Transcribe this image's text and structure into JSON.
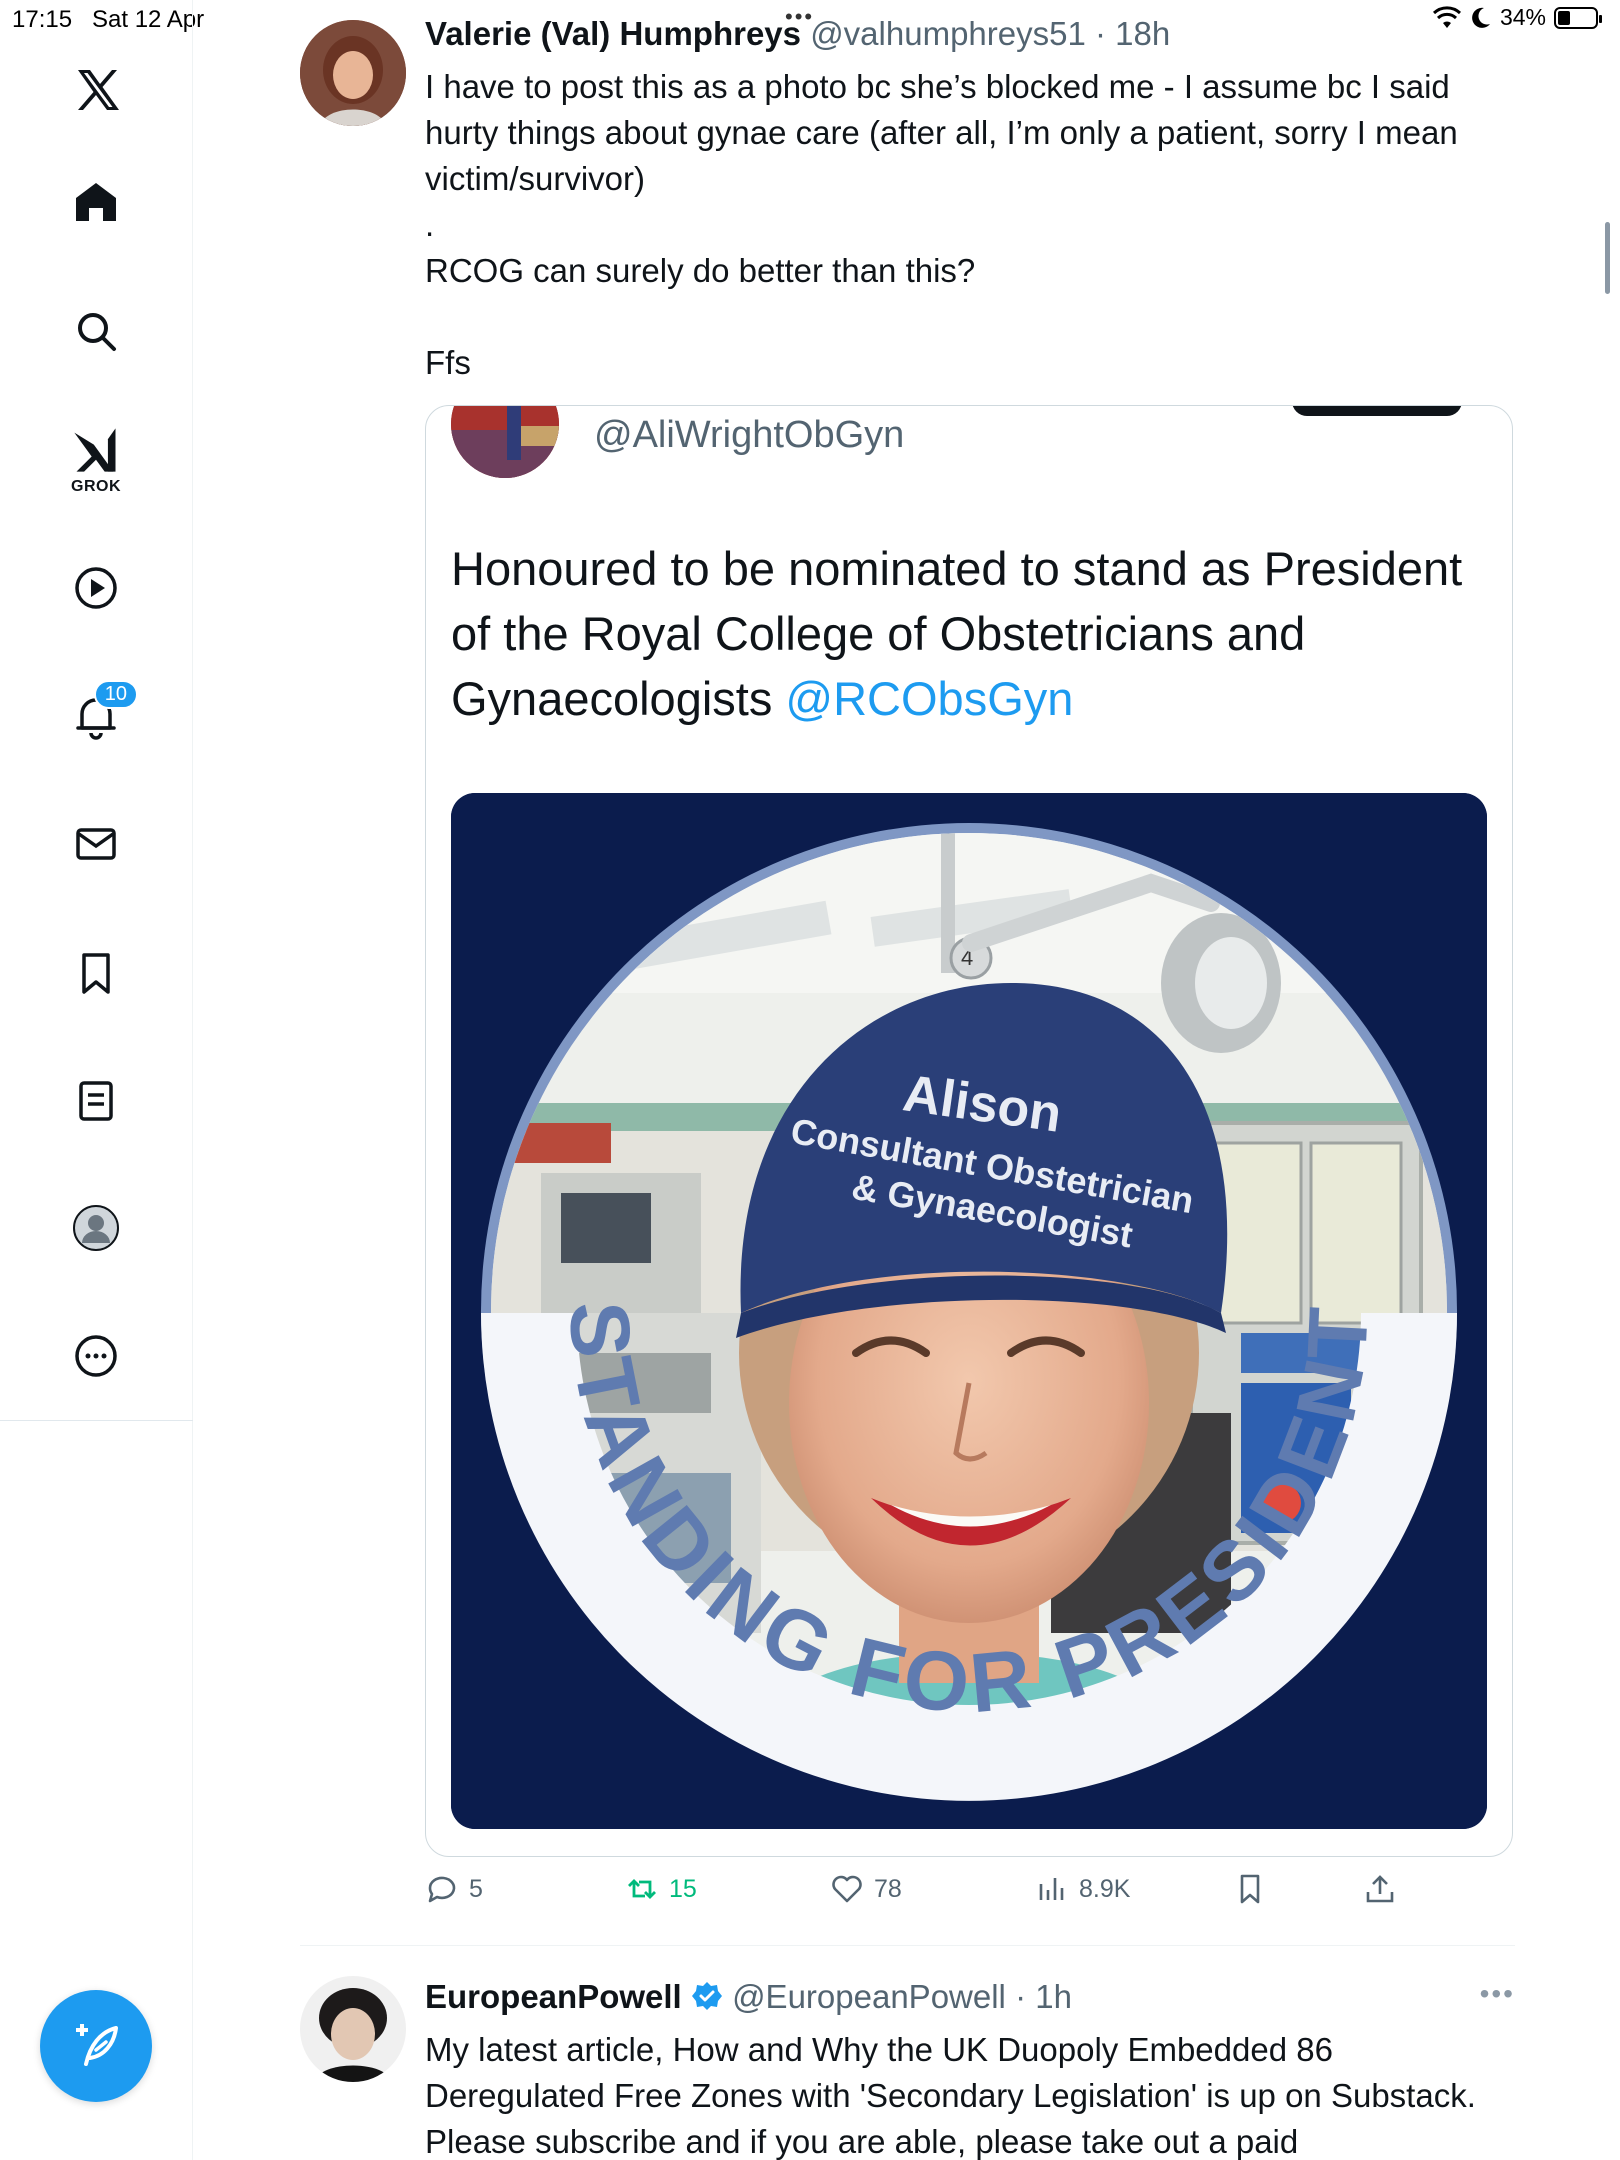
{
  "status_bar": {
    "time": "17:15",
    "date": "Sat 12 Apr",
    "battery": "34%",
    "battery_level": 0.34
  },
  "sidebar": {
    "grok_label": "GROK",
    "notifications_count": "10"
  },
  "tweet": {
    "author_name": "Valerie (Val) Humphreys",
    "author_handle": "@valhumphreys51",
    "time": "18h",
    "text_lines": [
      "I have to post this as a photo bc she’s blocked me - I assume bc I said hurty things about gynae care (after all, I’m only a patient, sorry I mean victim/survivor)",
      ".",
      "RCOG can surely do better than this?",
      "",
      "Ffs"
    ],
    "quote": {
      "handle": "@AliWrightObGyn",
      "text": "Honoured to be nominated to stand as President of the Royal College of Obstetricians and Gynaecologists",
      "mention": "@RCObsGyn",
      "image": {
        "cap_name": "Alison",
        "cap_line2": "Consultant Obstetrician",
        "cap_line3": "& Gynaecologist",
        "ring_text": "STANDING FOR PRESIDENT",
        "theater_number": "4",
        "colors": {
          "background": "#0b1c4d",
          "ring": "#ffffff",
          "ring_text": "#5f7bb0",
          "cap": "#2a3f78"
        }
      }
    },
    "actions": {
      "replies": "5",
      "reposts": "15",
      "likes": "78",
      "views": "8.9K"
    }
  },
  "tweet2": {
    "author_name": "EuropeanPowell",
    "author_handle": "@EuropeanPowell",
    "time": "1h",
    "text": "My latest article, How and Why the UK Duopoly Embedded 86 Deregulated Free Zones with 'Secondary Legislation' is up on Substack. Please subscribe and if you are able, please take out a paid"
  },
  "colors": {
    "accent": "#1d9bf0",
    "repost_green": "#00ba7c",
    "muted_text": "#536471"
  }
}
